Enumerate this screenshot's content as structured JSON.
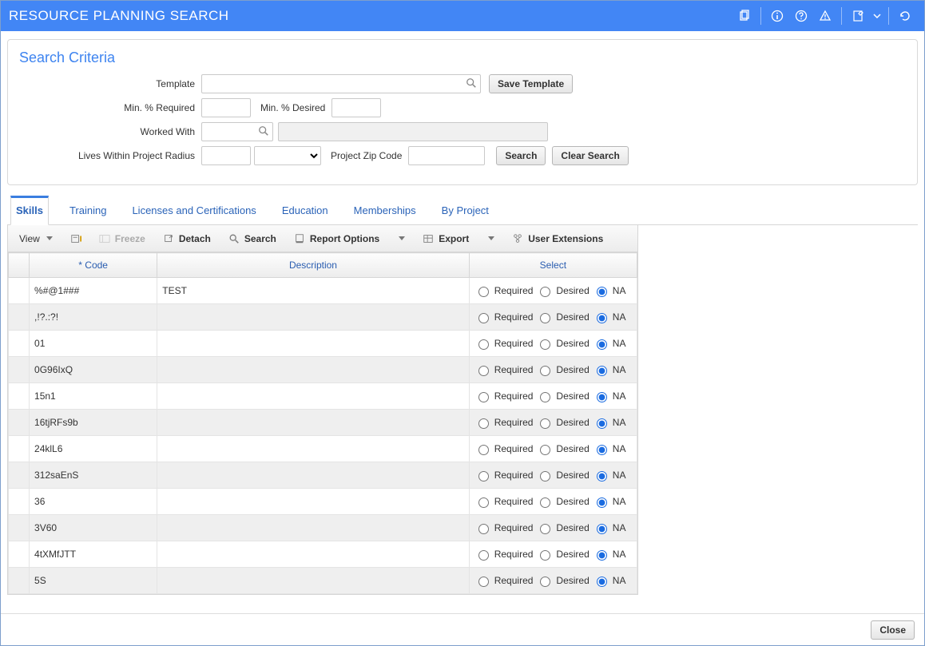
{
  "header": {
    "title": "RESOURCE PLANNING SEARCH",
    "icons": [
      "copy-icon",
      "info-icon",
      "help-icon",
      "warning-icon",
      "edit-icon",
      "refresh-icon"
    ]
  },
  "criteria": {
    "panel_title": "Search Criteria",
    "template_label": "Template",
    "save_template_btn": "Save Template",
    "min_required_label": "Min. % Required",
    "min_desired_label": "Min. % Desired",
    "worked_with_label": "Worked With",
    "lives_within_label": "Lives Within Project Radius",
    "project_zip_label": "Project Zip Code",
    "search_btn": "Search",
    "clear_btn": "Clear Search"
  },
  "tabs": [
    "Skills",
    "Training",
    "Licenses and Certifications",
    "Education",
    "Memberships",
    "By Project"
  ],
  "active_tab": 0,
  "toolbar": {
    "view": "View",
    "freeze": "Freeze",
    "detach": "Detach",
    "search": "Search",
    "report": "Report Options",
    "export": "Export",
    "userext": "User Extensions"
  },
  "table": {
    "col_code": "* Code",
    "col_desc": "Description",
    "col_select": "Select",
    "option_required": "Required",
    "option_desired": "Desired",
    "option_na": "NA",
    "rows": [
      {
        "code": "%#@1###",
        "desc": "TEST",
        "sel": "NA"
      },
      {
        "code": ",!?.:?!",
        "desc": "",
        "sel": "NA"
      },
      {
        "code": "01",
        "desc": "",
        "sel": "NA"
      },
      {
        "code": "0G96IxQ",
        "desc": "",
        "sel": "NA"
      },
      {
        "code": "15n1",
        "desc": "",
        "sel": "NA"
      },
      {
        "code": "16tjRFs9b",
        "desc": "",
        "sel": "NA"
      },
      {
        "code": "24klL6",
        "desc": "",
        "sel": "NA"
      },
      {
        "code": "312saEnS",
        "desc": "",
        "sel": "NA"
      },
      {
        "code": "36",
        "desc": "",
        "sel": "NA"
      },
      {
        "code": "3V60",
        "desc": "",
        "sel": "NA"
      },
      {
        "code": "4tXMfJTT",
        "desc": "",
        "sel": "NA"
      },
      {
        "code": "5S",
        "desc": "",
        "sel": "NA"
      }
    ]
  },
  "footer": {
    "close_btn": "Close"
  }
}
